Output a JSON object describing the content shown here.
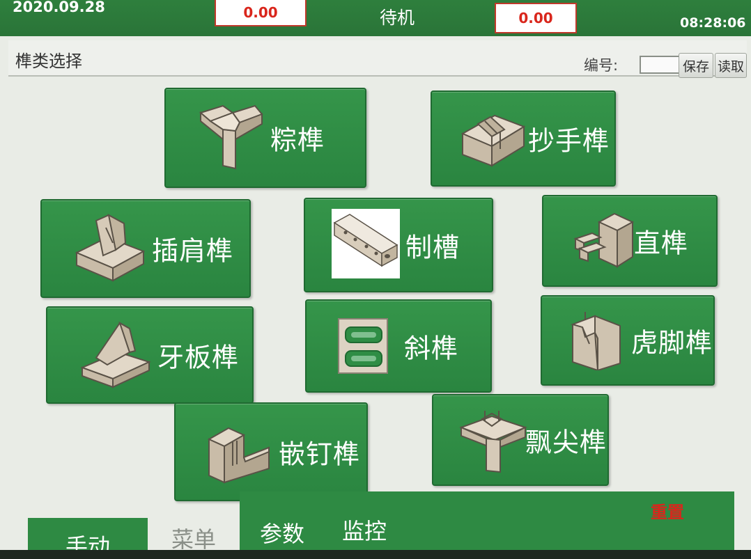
{
  "status_bar": {
    "date": "2020.09.28",
    "reading_left": "0.00",
    "mode": "待机",
    "reading_right": "0.00",
    "time": "08:28:06"
  },
  "header": {
    "title": "榫类选择",
    "number_label": "编号:",
    "number_value": "",
    "save_label": "保存",
    "load_label": "读取"
  },
  "tenon_types": [
    {
      "id": "zong",
      "label": "粽榫",
      "icon": "y-joint-icon"
    },
    {
      "id": "chaoshou",
      "label": "抄手榫",
      "icon": "slotted-block-icon"
    },
    {
      "id": "chajian",
      "label": "插肩榫",
      "icon": "shoulder-block-icon"
    },
    {
      "id": "zhicao",
      "label": "制槽",
      "icon": "grooved-beam-icon"
    },
    {
      "id": "zhi",
      "label": "直榫",
      "icon": "straight-tenon-icon"
    },
    {
      "id": "yaban",
      "label": "牙板榫",
      "icon": "tooth-board-icon"
    },
    {
      "id": "xie",
      "label": "斜榫",
      "icon": "slanted-tenon-icon"
    },
    {
      "id": "hujiao",
      "label": "虎脚榫",
      "icon": "tiger-foot-icon"
    },
    {
      "id": "qianding",
      "label": "嵌钉榫",
      "icon": "nail-inlay-icon"
    },
    {
      "id": "piaojian",
      "label": "飘尖榫",
      "icon": "floating-tip-icon"
    }
  ],
  "footer": {
    "reset_label": "重置",
    "tabs": [
      "手动",
      "菜单",
      "参数",
      "监控"
    ],
    "active_tab": "菜单"
  },
  "colors": {
    "primary_green": "#2e8a43",
    "alert_red": "#d9261c",
    "icon_wood": "#d4c9b7"
  }
}
